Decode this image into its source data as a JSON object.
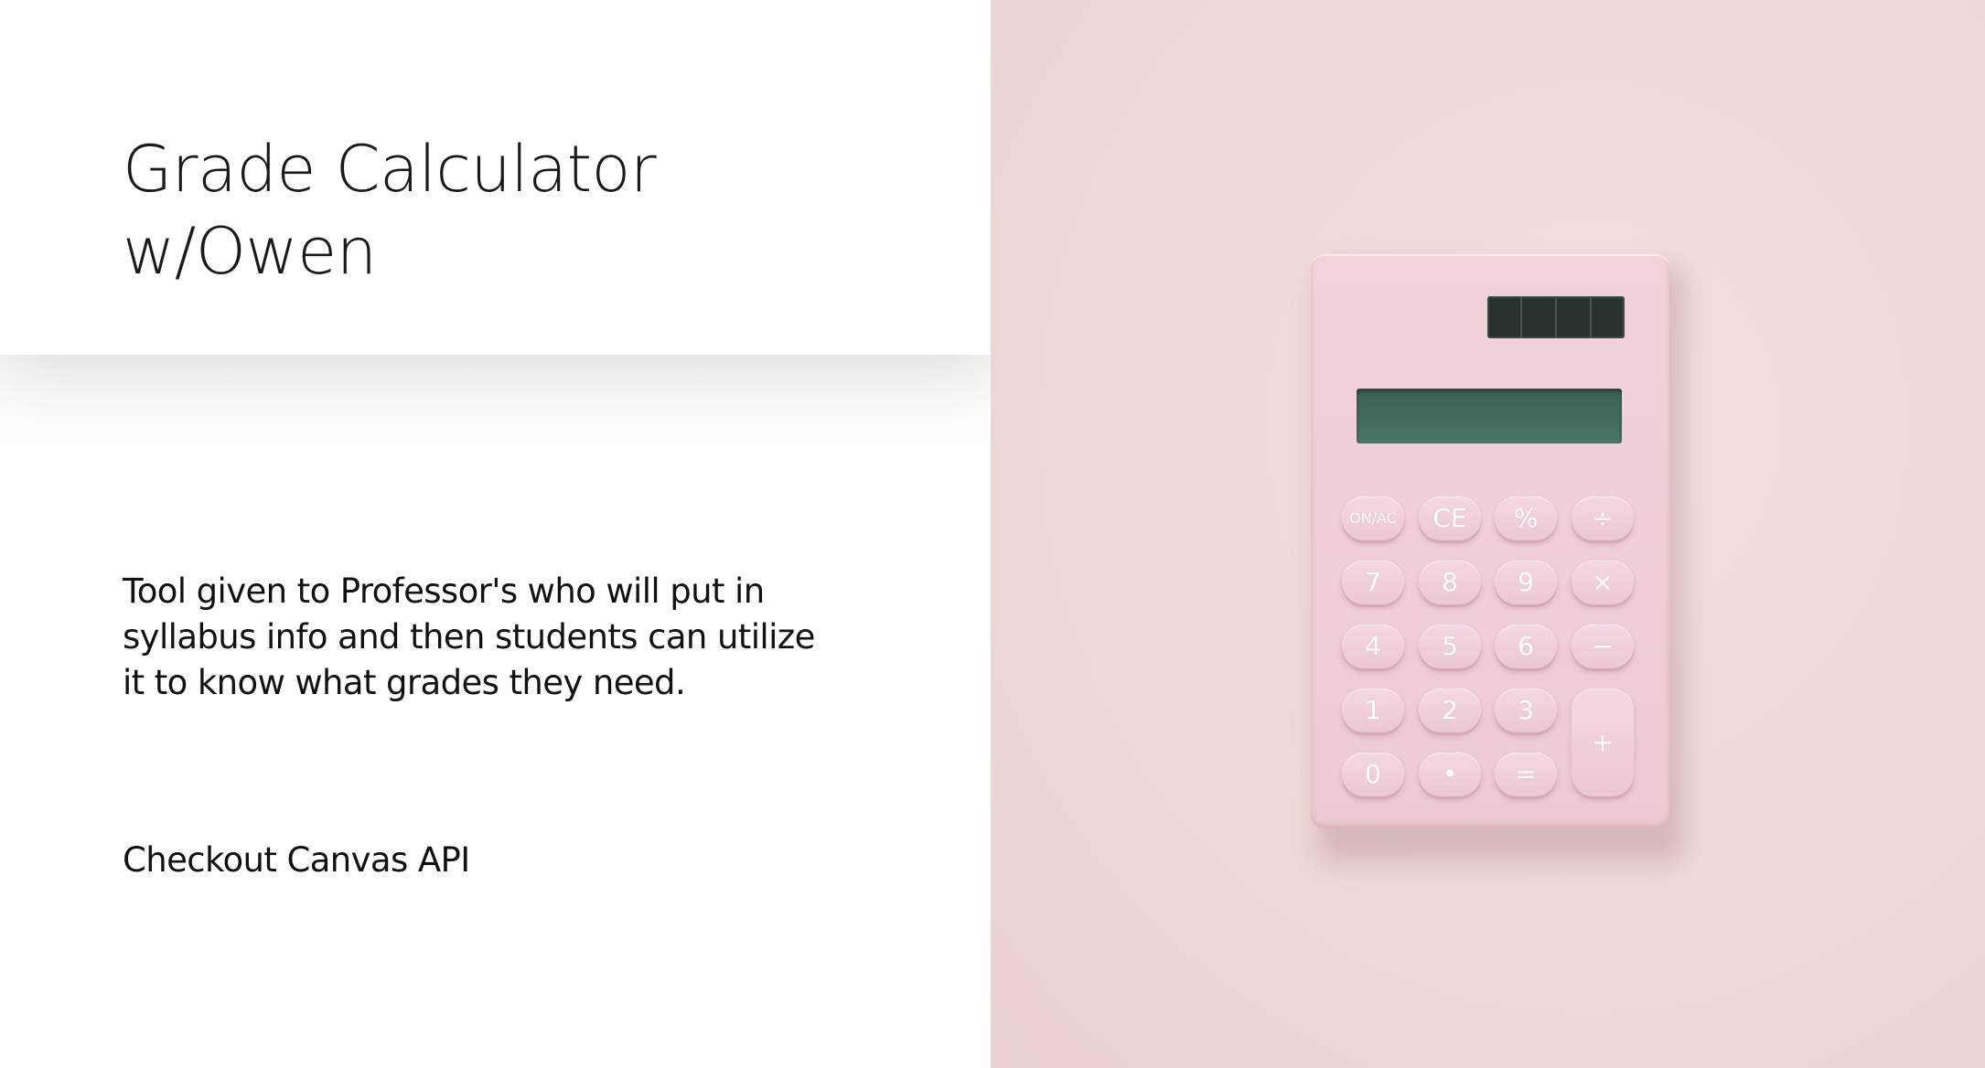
{
  "slide": {
    "title_lines": [
      "Grade Calculator",
      "w/Owen"
    ],
    "body_lines": [
      "Tool given to Professor's who will put in",
      "syllabus info and then students can utilize",
      "it to know what grades they need."
    ],
    "note": "Checkout Canvas API"
  },
  "photo": {
    "subject": "pink calculator",
    "background_color": "#efd8d7",
    "calculator_color": "#efcdd5",
    "display_color": "#456e5e",
    "keys": {
      "row1": [
        "ON/AC",
        "CE",
        "%",
        "÷"
      ],
      "row2": [
        "7",
        "8",
        "9",
        "×"
      ],
      "row3": [
        "4",
        "5",
        "6",
        "−"
      ],
      "row4": [
        "1",
        "2",
        "3",
        "+"
      ],
      "row5": [
        "0",
        "•",
        "="
      ]
    }
  }
}
